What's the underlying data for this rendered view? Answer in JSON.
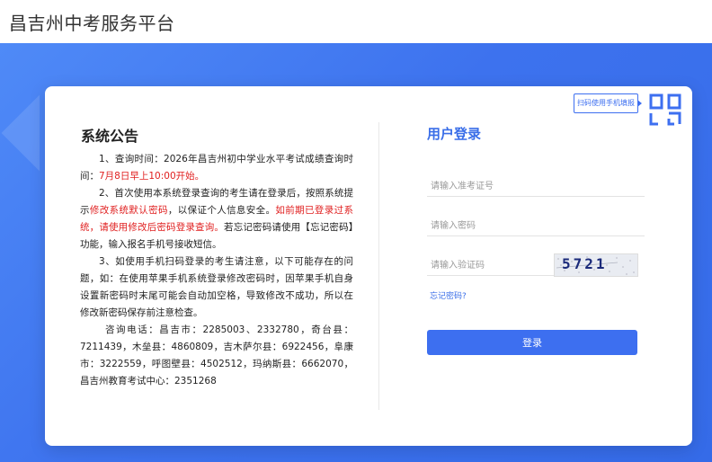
{
  "header": {
    "title": "昌吉州中考服务平台"
  },
  "notice": {
    "title": "系统公告",
    "p1_a": "1、查询时间：2026年昌吉州初中学业水平考试成绩查询时间：",
    "p1_red": "7月8日早上10:00开始。",
    "p2_a": "2、首次使用本系统登录查询的考生请在登录后，按照系统提示",
    "p2_red1": "修改系统默认密码",
    "p2_b": "，以保证个人信息安全。",
    "p2_red2": "如前期已登录过系统，请使用修改后密码登录查询。",
    "p2_c": "若忘记密码请使用【忘记密码】功能，输入报名手机号接收短信。",
    "p3": "3、如使用手机扫码登录的考生请注意，以下可能存在的问题，如：在使用苹果手机系统登录修改密码时，因苹果手机自身设置新密码时末尾可能会自动加空格，导致修改不成功，所以在修改新密码保存前注意检查。",
    "contact": "咨询电话：昌吉市：2285003、2332780，奇台县：7211439，木垒县：4860809，吉木萨尔县：6922456，阜康市：3222559，呼图壁县：4502512，玛纳斯县：6662070，昌吉州教育考试中心：2351268"
  },
  "login": {
    "title": "用户登录",
    "exam_no_placeholder": "请输入准考证号",
    "password_placeholder": "请输入密码",
    "captcha_placeholder": "请输入验证码",
    "captcha_text": "5721",
    "forgot_label": "忘记密码?",
    "submit_label": "登录",
    "qr_tip": "扫码使用手机填报"
  },
  "colors": {
    "accent": "#3d6ff0",
    "warning": "#e02020",
    "hero": "#3d72ee"
  }
}
